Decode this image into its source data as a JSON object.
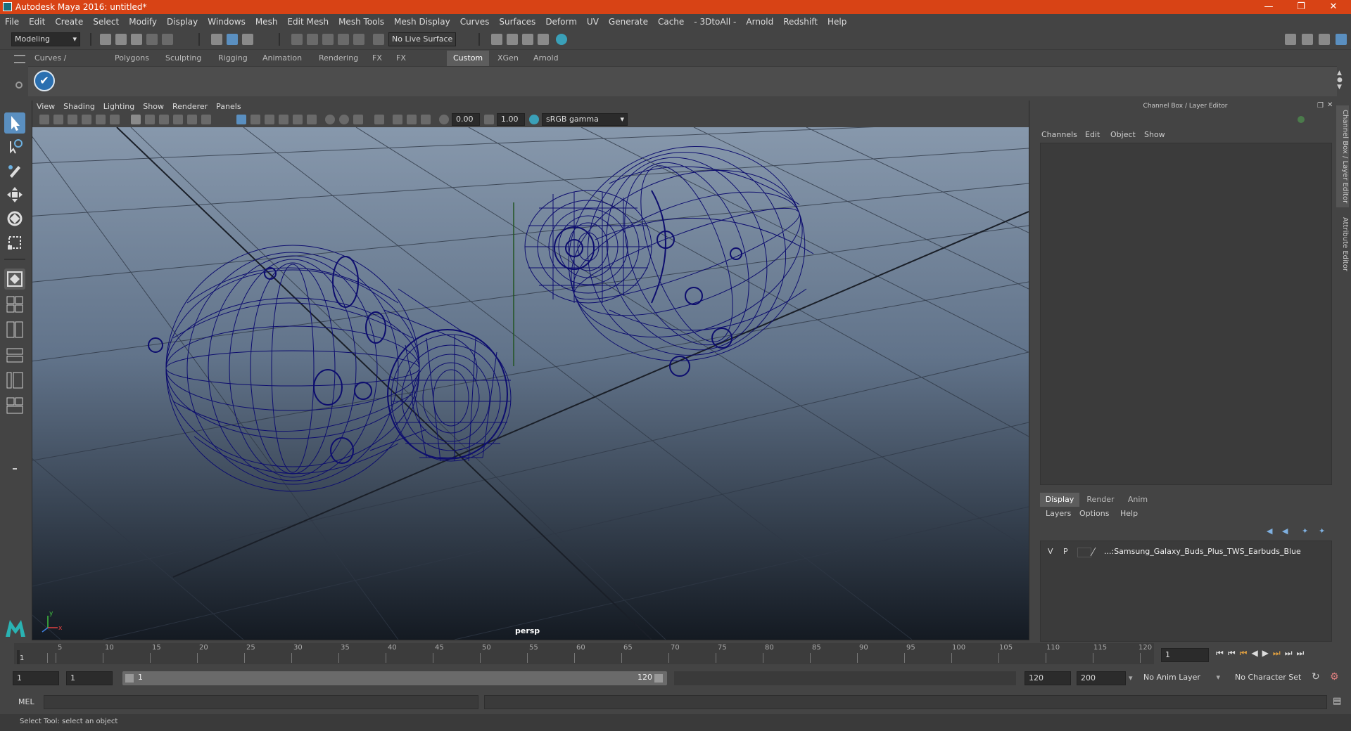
{
  "window": {
    "title": "Autodesk Maya 2016: untitled*"
  },
  "menubar": [
    "File",
    "Edit",
    "Create",
    "Select",
    "Modify",
    "Display",
    "Windows",
    "Mesh",
    "Edit Mesh",
    "Mesh Tools",
    "Mesh Display",
    "Curves",
    "Surfaces",
    "Deform",
    "UV",
    "Generate",
    "Cache",
    "- 3DtoAll -",
    "Arnold",
    "Redshift",
    "Help"
  ],
  "toolbar": {
    "mode": "Modeling",
    "live_surface": "No Live Surface"
  },
  "shelf_tabs": [
    "Curves / Surfaces",
    "Polygons",
    "Sculpting",
    "Rigging",
    "Animation",
    "Rendering",
    "FX",
    "FX Caching",
    "Custom",
    "XGen",
    "Arnold"
  ],
  "shelf_active": "Custom",
  "viewport": {
    "menu": [
      "View",
      "Shading",
      "Lighting",
      "Show",
      "Renderer",
      "Panels"
    ],
    "exposure": "0.00",
    "gamma": "1.00",
    "color_space": "sRGB gamma",
    "camera": "persp",
    "axis_x": "x",
    "axis_y": "y"
  },
  "channel_box": {
    "title": "Channel Box / Layer Editor",
    "menu": [
      "Channels",
      "Edit",
      "Object",
      "Show"
    ],
    "side_tab_1": "Channel Box / Layer Editor",
    "side_tab_2": "Attribute Editor"
  },
  "layer_editor": {
    "tabs": [
      "Display",
      "Render",
      "Anim"
    ],
    "active_tab": "Display",
    "menu": [
      "Layers",
      "Options",
      "Help"
    ],
    "layer": {
      "v": "V",
      "p": "P",
      "name": "...:Samsung_Galaxy_Buds_Plus_TWS_Earbuds_Blue"
    }
  },
  "timeline": {
    "ticks": [
      "5",
      "10",
      "15",
      "20",
      "25",
      "30",
      "35",
      "40",
      "45",
      "50",
      "55",
      "60",
      "65",
      "70",
      "75",
      "80",
      "85",
      "90",
      "95",
      "100",
      "105",
      "110",
      "115",
      "120"
    ],
    "start_marker": "1",
    "current_frame": "1"
  },
  "range": {
    "start": "1",
    "anim_start": "1",
    "slider_start": "1",
    "slider_end": "120",
    "range_end": "120",
    "anim_end": "200",
    "anim_layer": "No Anim Layer",
    "character_set": "No Character Set"
  },
  "command": {
    "label": "MEL"
  },
  "helpline": {
    "text": "Select Tool: select an object"
  },
  "colors": {
    "titlebar": "#d84315",
    "wireframe": "#0d0d6e",
    "bg": "#444444"
  }
}
